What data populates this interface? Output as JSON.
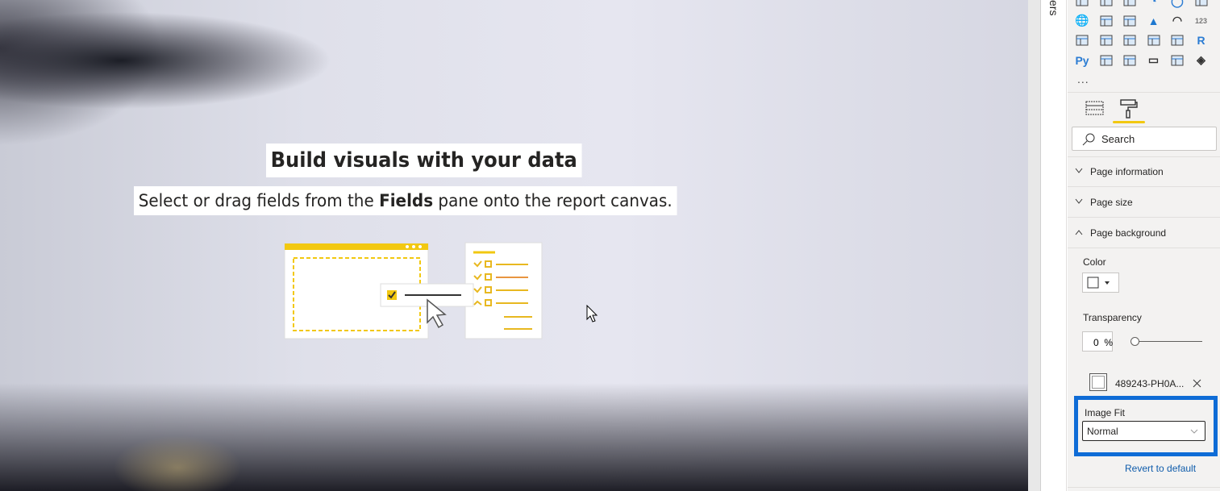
{
  "canvas": {
    "title": "Build visuals with your data",
    "subtitle_pre": "Select or drag fields from the ",
    "subtitle_bold": "Fields",
    "subtitle_post": " pane onto the report canvas."
  },
  "filters_pane": {
    "label": "ers"
  },
  "visualizations": {
    "icons": [
      "matrix-icon",
      "funnel-icon",
      "scatter-icon",
      "pie-icon",
      "donut-icon",
      "treemap-icon",
      "map-icon",
      "filled-map-icon",
      "shape-map-icon",
      "azure-map-icon",
      "gauge-icon",
      "card-icon",
      "multi-row-card-icon",
      "kpi-icon",
      "slicer-icon",
      "table-icon",
      "matrix-table-icon",
      "r-visual-icon",
      "python-visual-icon",
      "key-influencers-icon",
      "decomposition-tree-icon",
      "qa-icon",
      "smart-narrative-icon",
      "power-apps-icon"
    ],
    "more": "...",
    "accent": "#f2c811"
  },
  "format": {
    "search_placeholder": "Search",
    "sections": [
      {
        "label": "Page information",
        "expanded": false
      },
      {
        "label": "Page size",
        "expanded": false
      },
      {
        "label": "Page background",
        "expanded": true
      }
    ],
    "color_label": "Color",
    "transparency_label": "Transparency",
    "transparency_value": "0",
    "transparency_unit": "%",
    "image_name": "489243-PH0A...",
    "image_fit_label": "Image Fit",
    "image_fit_value": "Normal",
    "revert": "Revert to default",
    "highlight_color": "#0f6cd6"
  }
}
